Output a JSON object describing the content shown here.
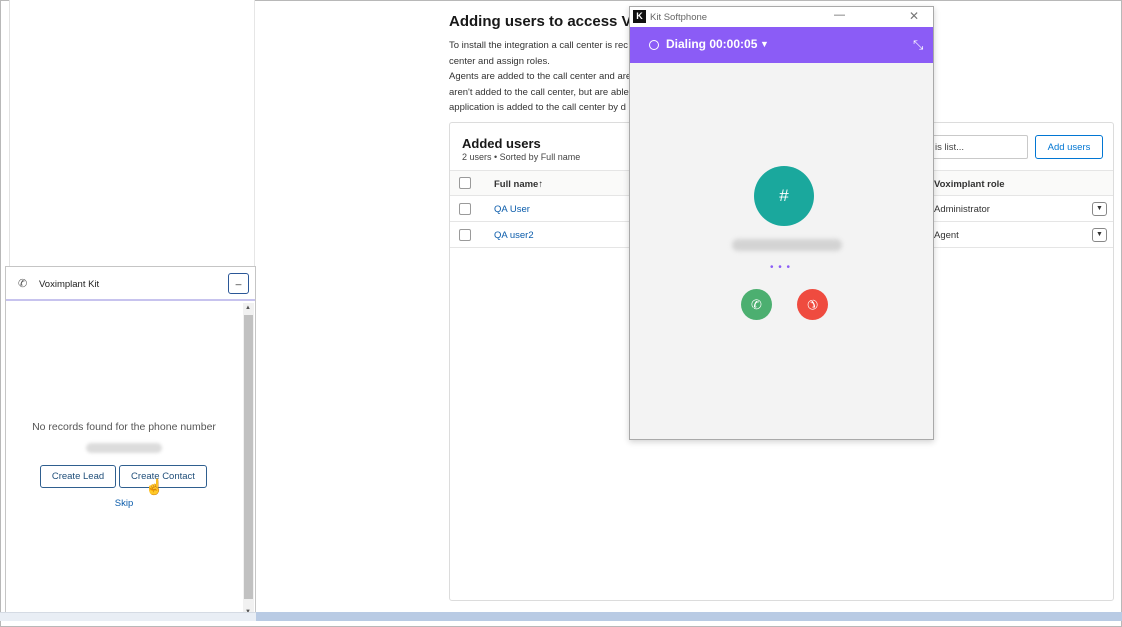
{
  "page": {
    "heading": "Adding users to access Voxim",
    "description": [
      "To install the integration a call center is rec",
      "center and assign roles.",
      "Agents are added to the call center and are",
      "aren't added to the call center, but are able",
      "application is added to the call center by d"
    ],
    "card": {
      "title": "Added users",
      "subtitle": "2 users • Sorted by Full name",
      "search_text": "is list...",
      "add_button": "Add users",
      "columns": {
        "full_name": "Full name↑",
        "role": "Voximplant role"
      },
      "rows": [
        {
          "name": "QA User",
          "role": "Administrator"
        },
        {
          "name": "QA user2",
          "role": "Agent"
        }
      ],
      "dropdown_glyph": "▼"
    }
  },
  "left_panel": {
    "title": "Voximplant Kit",
    "phone_icon": "phone-icon",
    "minimize_glyph": "_",
    "empty_message": "No records found for the phone number",
    "create_lead": "Create Lead",
    "create_contact": "Create Contact",
    "skip": "Skip",
    "scroll_up": "▲",
    "scroll_down": "▼"
  },
  "softphone": {
    "window_title": "Kit Softphone",
    "logo_glyph": "K",
    "minimize_glyph": "—",
    "close_glyph": "✕",
    "status": "Dialing 00:00:05",
    "caret": "▼",
    "collapse_glyph": "⤡",
    "avatar_symbol": "#",
    "dots": "• • •",
    "accept_glyph": "✆",
    "decline_glyph": "✆",
    "colors": {
      "bar": "#8b5cf6",
      "avatar": "#1aa89d",
      "accept": "#4caf70",
      "decline": "#ef4b3f"
    }
  }
}
